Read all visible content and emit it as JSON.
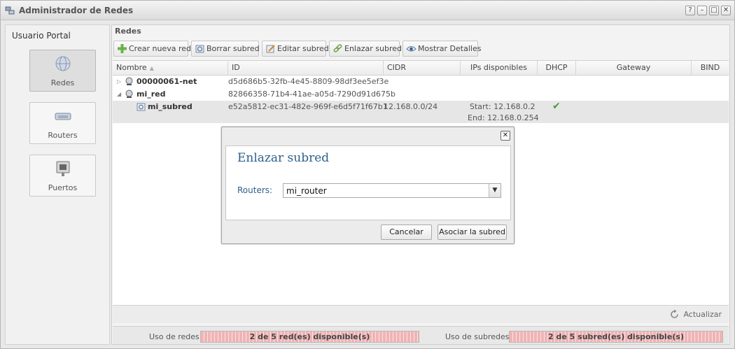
{
  "window": {
    "title": "Administrador de Redes",
    "controls": [
      "?",
      "–",
      "□",
      "✕"
    ]
  },
  "sidebar": {
    "title": "Usuario Portal",
    "items": [
      {
        "label": "Redes",
        "icon": "globe-network-icon",
        "active": true
      },
      {
        "label": "Routers",
        "icon": "router-icon",
        "active": false
      },
      {
        "label": "Puertos",
        "icon": "port-icon",
        "active": false
      }
    ]
  },
  "main": {
    "title": "Redes",
    "toolbar": [
      {
        "label": "Crear nueva red",
        "icon": "plus-icon"
      },
      {
        "label": "Borrar subred",
        "icon": "delete-subnet-icon"
      },
      {
        "label": "Editar subred",
        "icon": "edit-icon"
      },
      {
        "label": "Enlazar subred",
        "icon": "link-icon"
      },
      {
        "label": "Mostrar Detalles",
        "icon": "eye-icon"
      }
    ],
    "columns": [
      "Nombre",
      "ID",
      "CIDR",
      "IPs disponibles",
      "DHCP",
      "Gateway",
      "BIND"
    ],
    "rows": [
      {
        "name": "00000061-net",
        "id": "d5d686b5-32fb-4e45-8809-98df3ee5ef3e",
        "expander": "▷"
      },
      {
        "name": "mi_red",
        "id": "82866358-71b4-41ae-a05d-7290d91d675b",
        "expander": "◢"
      },
      {
        "name": "mi_subred",
        "id": "e52a5812-ec31-482e-969f-e6d5f71f67b1",
        "cidr": "12.168.0.0/24",
        "ips_start": "Start: 12.168.0.2",
        "ips_end": "End: 12.168.0.254",
        "dhcp": "✔"
      }
    ],
    "refresh_label": "Actualizar"
  },
  "usage": {
    "networks_label": "Uso de redes:",
    "networks_text": "2 de 5 red(es) disponible(s)",
    "networks_fraction": 0.4,
    "subnets_label": "Uso de subredes:",
    "subnets_text": "2 de 5 subred(es) disponible(s)",
    "subnets_fraction": 0.4
  },
  "dialog": {
    "title": "Enlazar subred",
    "close": "✕",
    "field_label": "Routers:",
    "select_value": "mi_router",
    "select_arrow": "▼",
    "cancel_label": "Cancelar",
    "submit_label": "Asociar la subred"
  },
  "colors": {
    "accent": "#2d5f8a",
    "progress": "#f0b4b4",
    "check": "#4a9a3a"
  }
}
